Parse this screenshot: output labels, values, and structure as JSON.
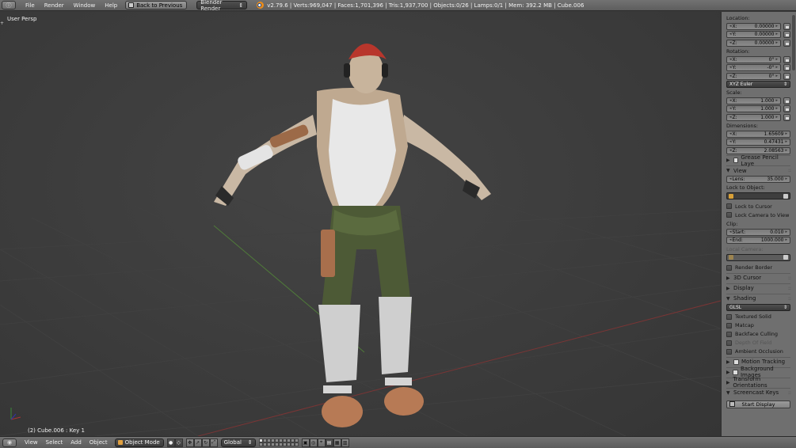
{
  "top_header": {
    "editor_type_icon": "info-icon",
    "menus": [
      "File",
      "Render",
      "Window",
      "Help"
    ],
    "back_button": "Back to Previous",
    "render_engine": "Blender Render",
    "stats": "v2.79.6 | Verts:969,047 | Faces:1,701,396 | Tris:1,937,700 | Objects:0/26 | Lamps:0/1 | Mem: 392.2 MB | Cube.006"
  },
  "viewport": {
    "view_label": "User Persp",
    "object_label": "(2) Cube.006 : Key 1"
  },
  "properties": {
    "location_label": "Location:",
    "location": [
      {
        "axis": "X:",
        "value": "0.00000"
      },
      {
        "axis": "Y:",
        "value": "0.00000"
      },
      {
        "axis": "Z:",
        "value": "0.00000"
      }
    ],
    "rotation_label": "Rotation:",
    "rotation": [
      {
        "axis": "X:",
        "value": "0°"
      },
      {
        "axis": "Y:",
        "value": "-0°"
      },
      {
        "axis": "Z:",
        "value": "0°"
      }
    ],
    "rotation_mode": "XYZ Euler",
    "scale_label": "Scale:",
    "scale": [
      {
        "axis": "X:",
        "value": "1.000"
      },
      {
        "axis": "Y:",
        "value": "1.000"
      },
      {
        "axis": "Z:",
        "value": "1.000"
      }
    ],
    "dimensions_label": "Dimensions:",
    "dimensions": [
      {
        "axis": "X:",
        "value": "1.65609"
      },
      {
        "axis": "Y:",
        "value": "0.47431"
      },
      {
        "axis": "Z:",
        "value": "2.08563"
      }
    ],
    "grease_pencil_label": "Grease Pencil Laye",
    "view_section": "View",
    "lens_label": "Lens:",
    "lens_value": "35.000",
    "lock_to_object_label": "Lock to Object:",
    "lock_to_cursor": "Lock to Cursor",
    "lock_camera_to_view": "Lock Camera to View",
    "clip_label": "Clip:",
    "clip_start_label": "Start:",
    "clip_start_value": "0.010",
    "clip_end_label": "End:",
    "clip_end_value": "1000.000",
    "local_camera_label": "Local Camera:",
    "render_border": "Render Border",
    "cursor_section": "3D Cursor",
    "display_section": "Display",
    "shading_section": "Shading",
    "shading_mode": "GLSL",
    "textured_solid": "Textured Solid",
    "matcap": "Matcap",
    "backface_culling": "Backface Culling",
    "depth_of_field": "Depth Of Field",
    "ambient_occlusion": "Ambient Occlusion",
    "motion_tracking": "Motion Tracking",
    "background_images": "Background Images",
    "transform_orientations": "Transform Orientations",
    "screencast_keys": "Screencast Keys",
    "start_display": "Start Display"
  },
  "bottom_header": {
    "menus": [
      "View",
      "Select",
      "Add",
      "Object"
    ],
    "mode": "Object Mode",
    "orientation": "Global"
  },
  "colors": {
    "viewport_bg": "#3a3a3a",
    "panel_bg": "#6f6f6f",
    "header_bg": "#6a6a6a",
    "grid_x_axis": "#8a3a3a",
    "grid_y_axis": "#5a8a3a"
  }
}
